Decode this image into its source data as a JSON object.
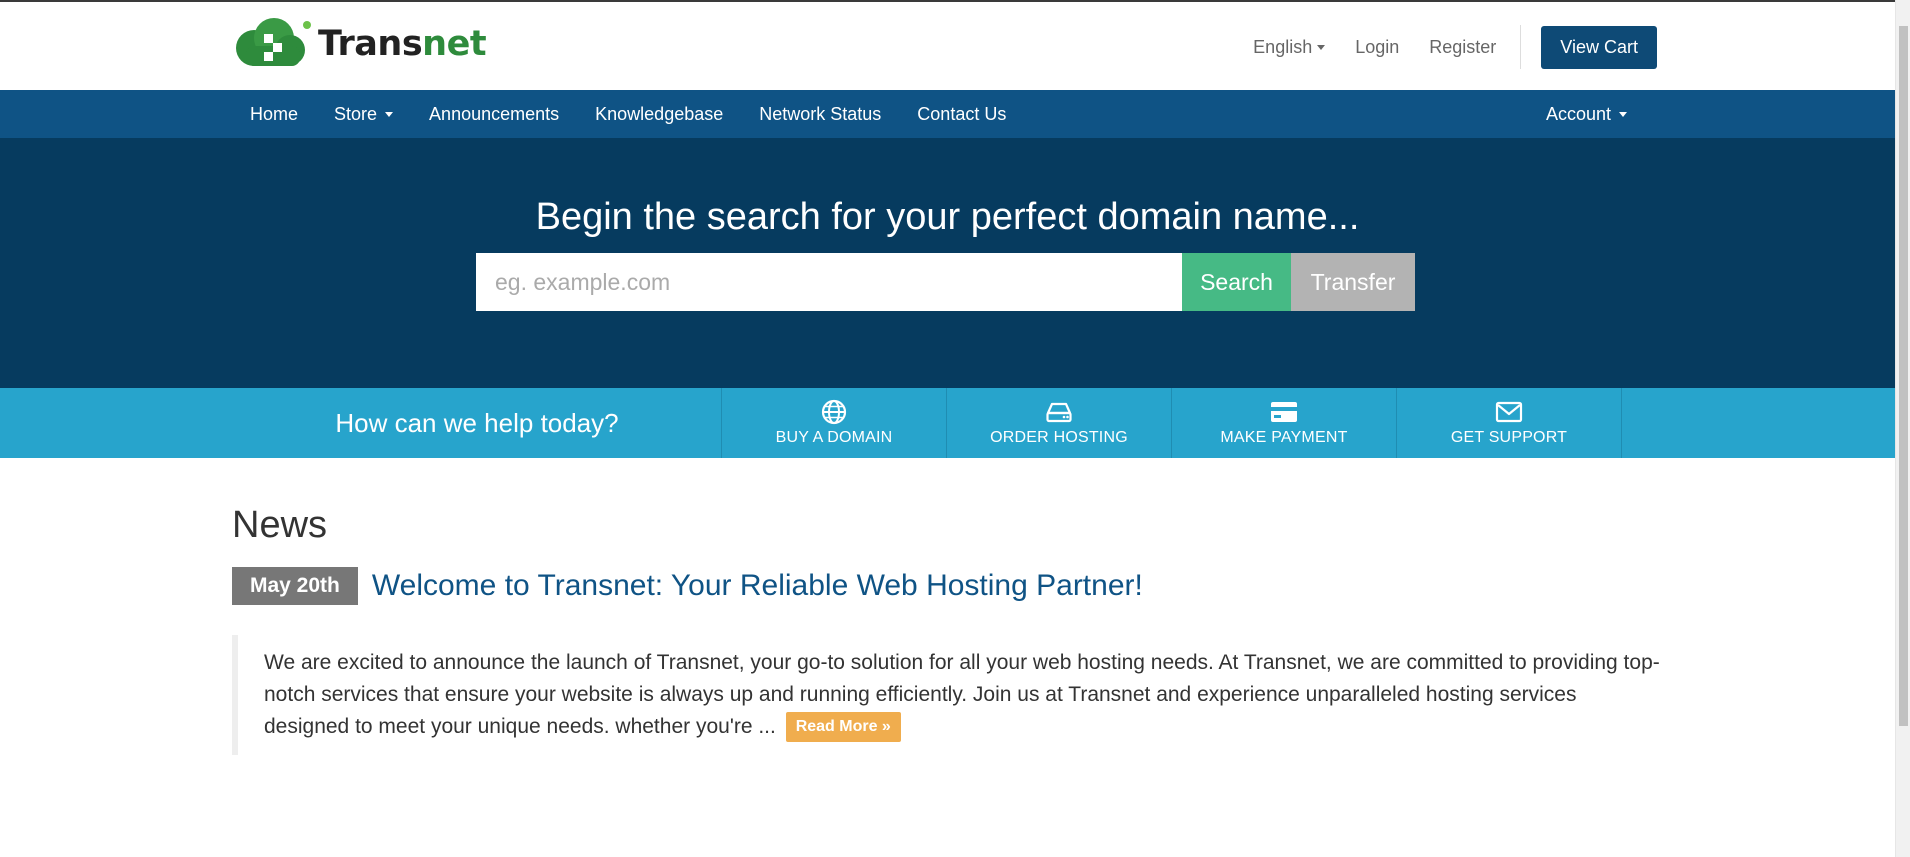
{
  "header": {
    "brand_name_part1": "Trans",
    "brand_name_part2": "net",
    "language": "English",
    "login": "Login",
    "register": "Register",
    "view_cart": "View Cart"
  },
  "nav": {
    "items": [
      {
        "label": "Home",
        "dropdown": false
      },
      {
        "label": "Store",
        "dropdown": true
      },
      {
        "label": "Announcements",
        "dropdown": false
      },
      {
        "label": "Knowledgebase",
        "dropdown": false
      },
      {
        "label": "Network Status",
        "dropdown": false
      },
      {
        "label": "Contact Us",
        "dropdown": false
      }
    ],
    "account": "Account"
  },
  "hero": {
    "title": "Begin the search for your perfect domain name...",
    "search_placeholder": "eg. example.com",
    "search_button": "Search",
    "transfer_button": "Transfer"
  },
  "helpbar": {
    "text": "How can we help today?",
    "actions": [
      {
        "label": "BUY A DOMAIN",
        "icon": "globe-icon"
      },
      {
        "label": "ORDER HOSTING",
        "icon": "server-icon"
      },
      {
        "label": "MAKE PAYMENT",
        "icon": "credit-card-icon"
      },
      {
        "label": "GET SUPPORT",
        "icon": "envelope-icon"
      }
    ]
  },
  "news": {
    "heading": "News",
    "items": [
      {
        "date": "May 20th",
        "title": "Welcome to Transnet: Your Reliable Web Hosting Partner!",
        "body": "We are excited to announce the launch of Transnet, your go-to solution for all your web hosting needs. At Transnet, we are committed to providing top-notch services that ensure your website is always up and running efficiently. Join us at Transnet and experience unparalleled hosting services designed to meet your unique needs. whether you're ...",
        "read_more": "Read More »"
      }
    ]
  },
  "colors": {
    "nav_bg": "#0f5385",
    "hero_bg": "#063b5f",
    "helpbar_bg": "#27a4cc",
    "search_button": "#46ba85",
    "transfer_button": "#b3b3b3",
    "read_more": "#f0ad4e",
    "logo_green": "#2e8b3c"
  }
}
